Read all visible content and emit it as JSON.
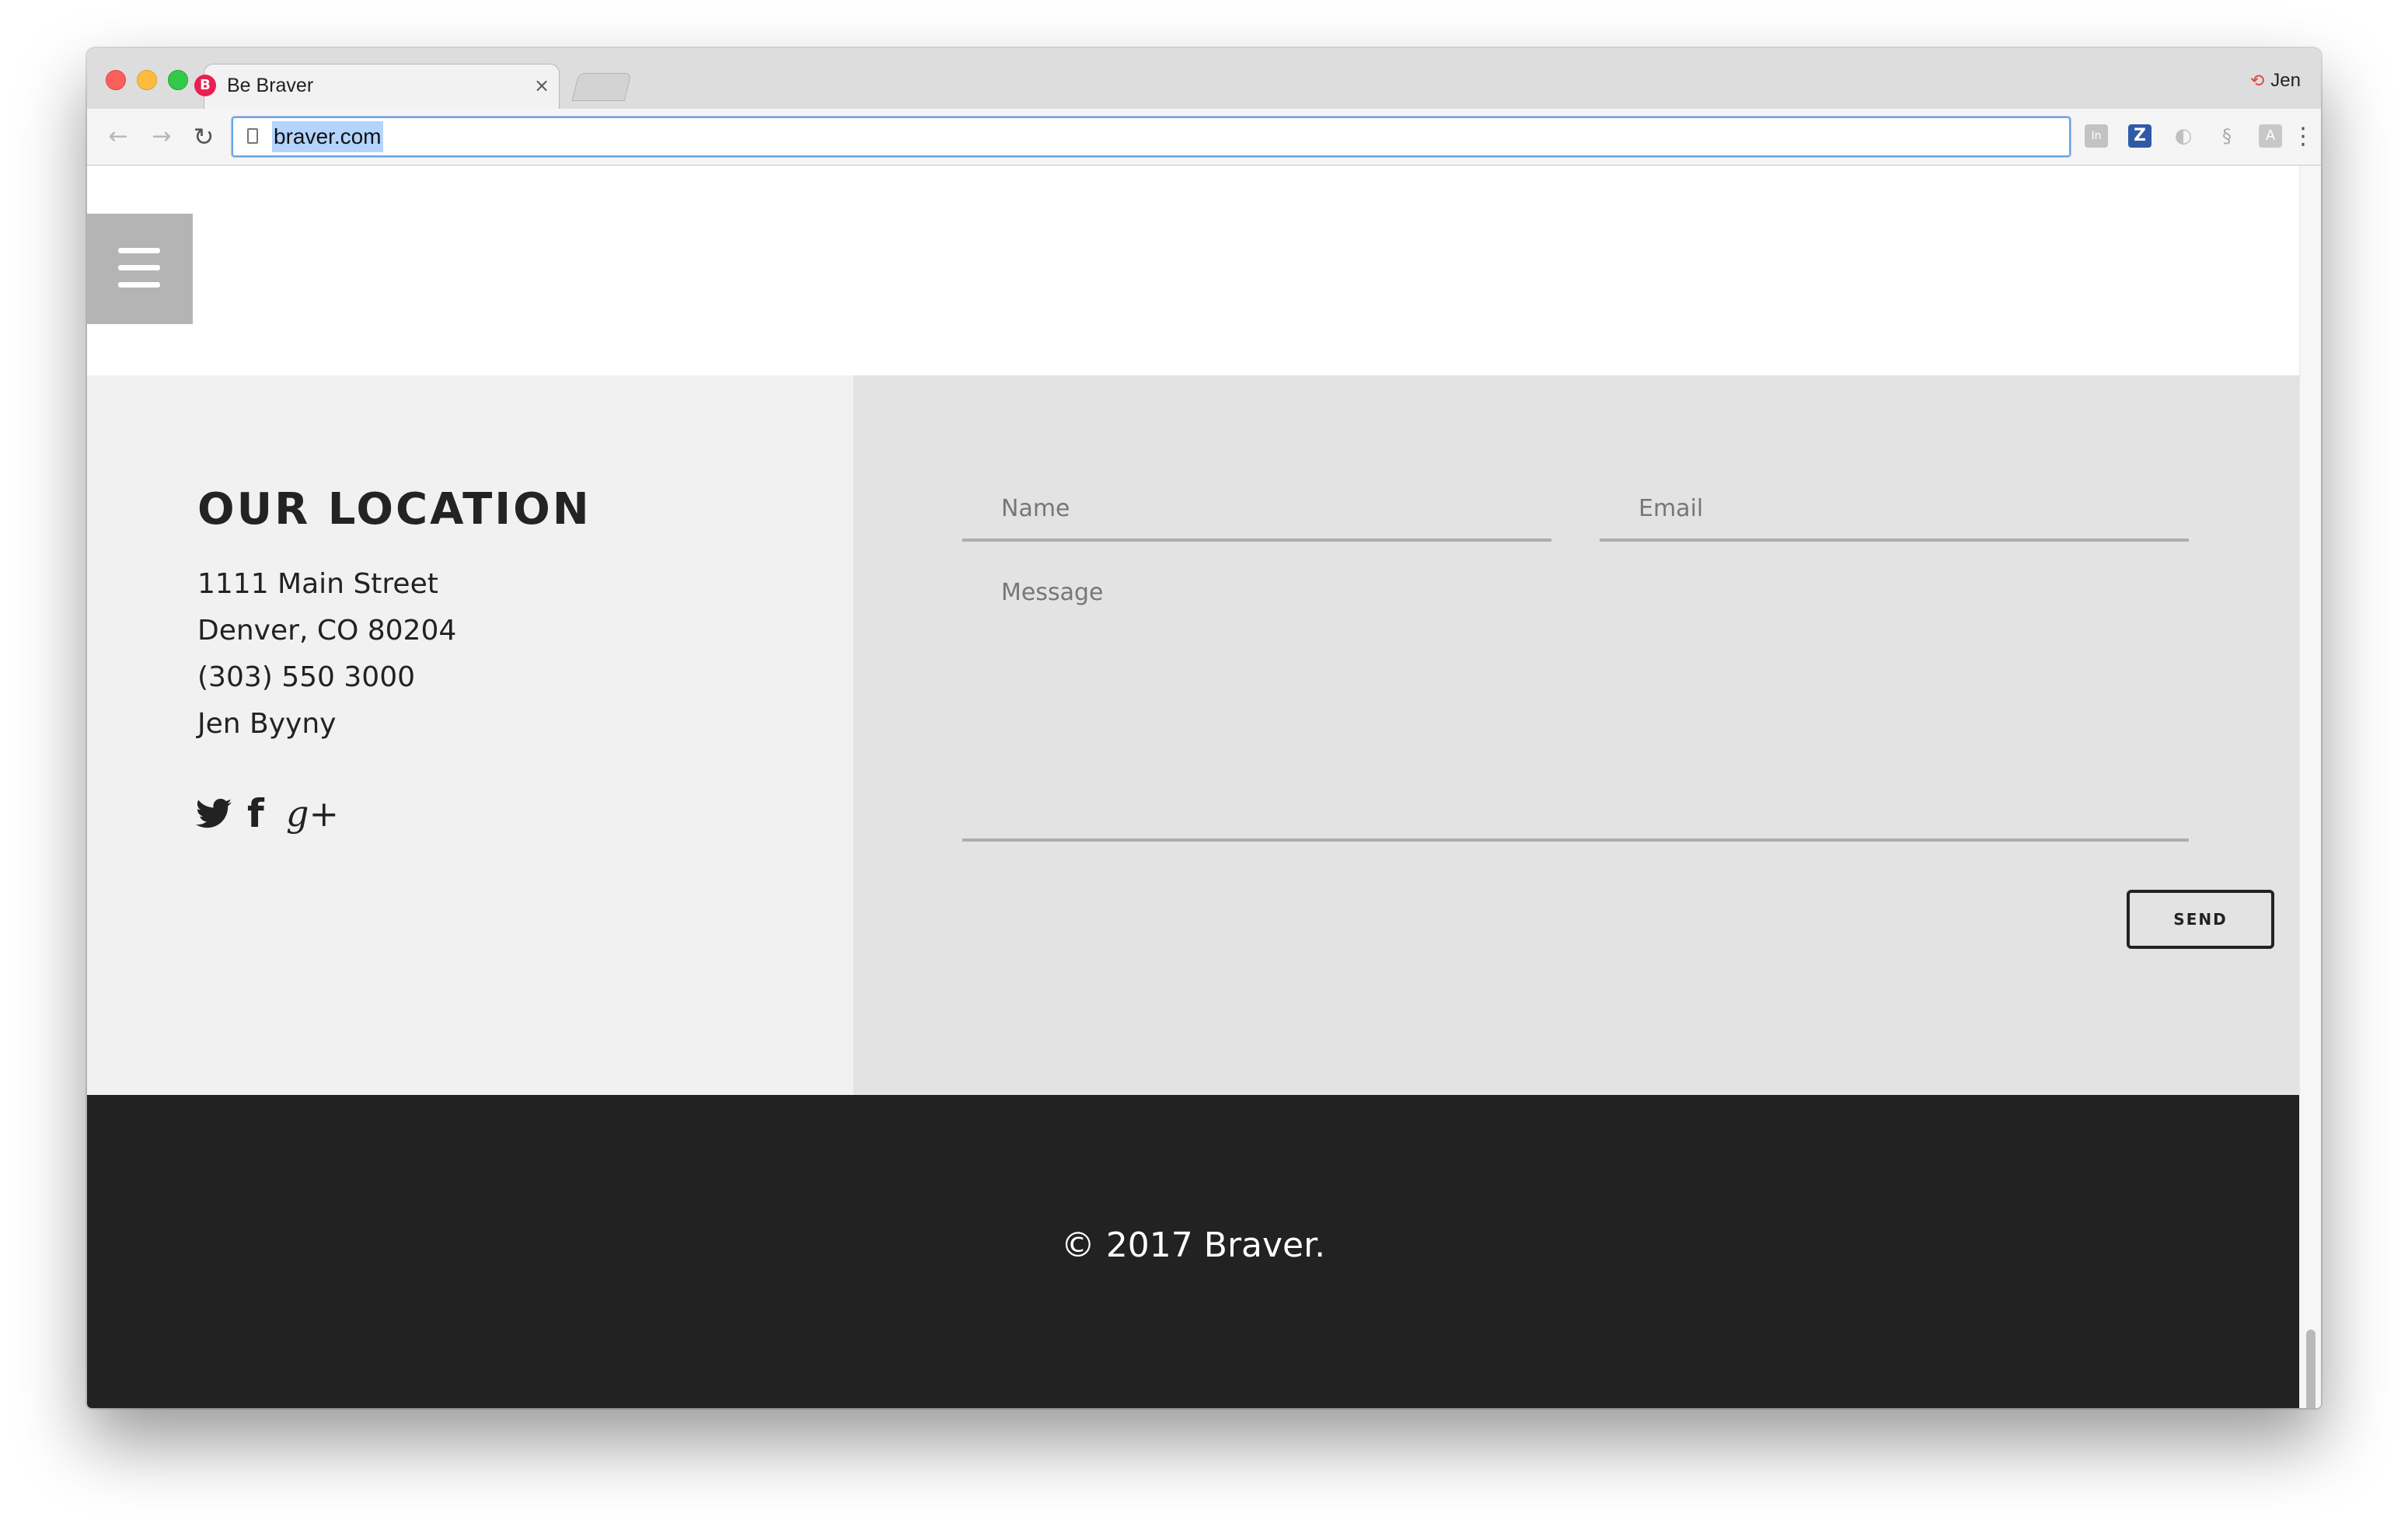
{
  "browser": {
    "tab_title": "Be Braver",
    "tab_favicon": "B",
    "tab_close": "×",
    "profile_name": "Jen",
    "url": "braver.com",
    "nav": {
      "back_icon": "←",
      "forward_icon": "→",
      "reload_icon": "↻"
    },
    "extensions": [
      {
        "name": "in-extension-icon",
        "glyph": "In"
      },
      {
        "name": "z-extension-icon",
        "glyph": "Z"
      },
      {
        "name": "swirl-extension-icon",
        "glyph": "◐"
      },
      {
        "name": "link-extension-icon",
        "glyph": "§"
      },
      {
        "name": "translate-extension-icon",
        "glyph": "A"
      }
    ],
    "menu_icon": "⋮"
  },
  "page": {
    "location": {
      "title": "OUR LOCATION",
      "street": "1111 Main Street",
      "city": "Denver, CO 80204",
      "phone": "(303) 550 3000",
      "name": "Jen Byyny"
    },
    "social": {
      "twitter_glyph": "🐦",
      "facebook_glyph": "f",
      "googleplus_glyph": "g+"
    },
    "form": {
      "name_placeholder": "Name",
      "email_placeholder": "Email",
      "message_placeholder": "Message",
      "send_label": "SEND"
    },
    "footer": {
      "copyright": "© 2017 Braver."
    }
  }
}
